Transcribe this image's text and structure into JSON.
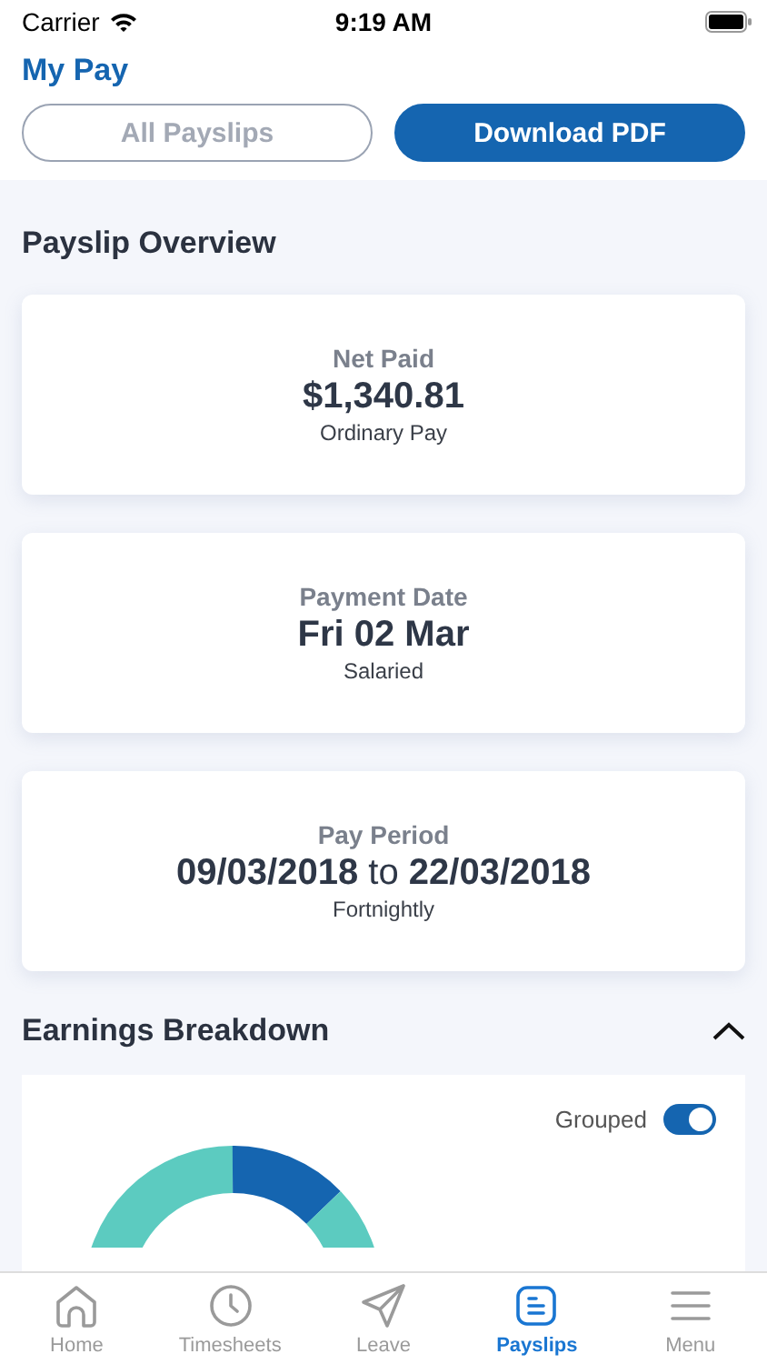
{
  "status_bar": {
    "carrier": "Carrier",
    "time": "9:19 AM"
  },
  "header": {
    "title": "My Pay",
    "buttons": [
      {
        "label": "All Payslips",
        "selected": false
      },
      {
        "label": "Download PDF",
        "selected": true
      }
    ]
  },
  "overview": {
    "title": "Payslip Overview",
    "cards": [
      {
        "kind": "plain",
        "label": "Net Paid",
        "value": "$1,340.81",
        "note": "Ordinary Pay"
      },
      {
        "kind": "plain",
        "label": "Payment Date",
        "value": "Fri 02 Mar",
        "note": "Salaried"
      },
      {
        "kind": "range",
        "label": "Pay Period",
        "value": "**09/03/2018** to **22/03/2018**",
        "note": "Fortnightly"
      }
    ]
  },
  "earnings": {
    "title": "Earnings Breakdown",
    "expanded": true,
    "toggle": {
      "label": "Grouped",
      "on": true
    }
  },
  "tab_bar": [
    {
      "label": "Home",
      "selected": false
    },
    {
      "label": "Timesheets",
      "selected": false
    },
    {
      "label": "Leave",
      "selected": false
    },
    {
      "label": "Payslips",
      "selected": true
    },
    {
      "label": "Menu",
      "selected": false
    }
  ]
}
